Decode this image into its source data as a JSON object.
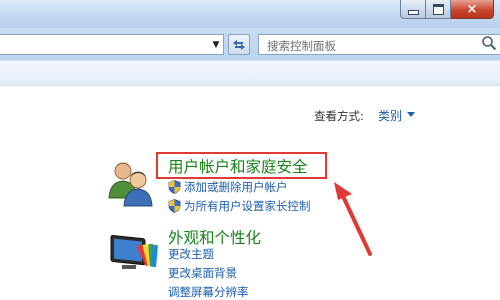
{
  "window": {
    "close_symbol": "×"
  },
  "search": {
    "placeholder": "搜索控制面板"
  },
  "view": {
    "label": "查看方式:",
    "value": "类别"
  },
  "categories": [
    {
      "title": "用户帐户和家庭安全",
      "icon": "users-icon",
      "links": [
        {
          "label": "添加或删除用户帐户",
          "icon": "shield-icon"
        },
        {
          "label": "为所有用户设置家长控制",
          "icon": "shield-icon"
        }
      ]
    },
    {
      "title": "外观和个性化",
      "icon": "appearance-icon",
      "links": [
        {
          "label": "更改主题"
        },
        {
          "label": "更改桌面背景"
        },
        {
          "label": "调整屏幕分辨率"
        }
      ]
    }
  ],
  "colors": {
    "category_title": "#18841a",
    "link": "#1e5fad",
    "highlight": "#e03a37"
  }
}
